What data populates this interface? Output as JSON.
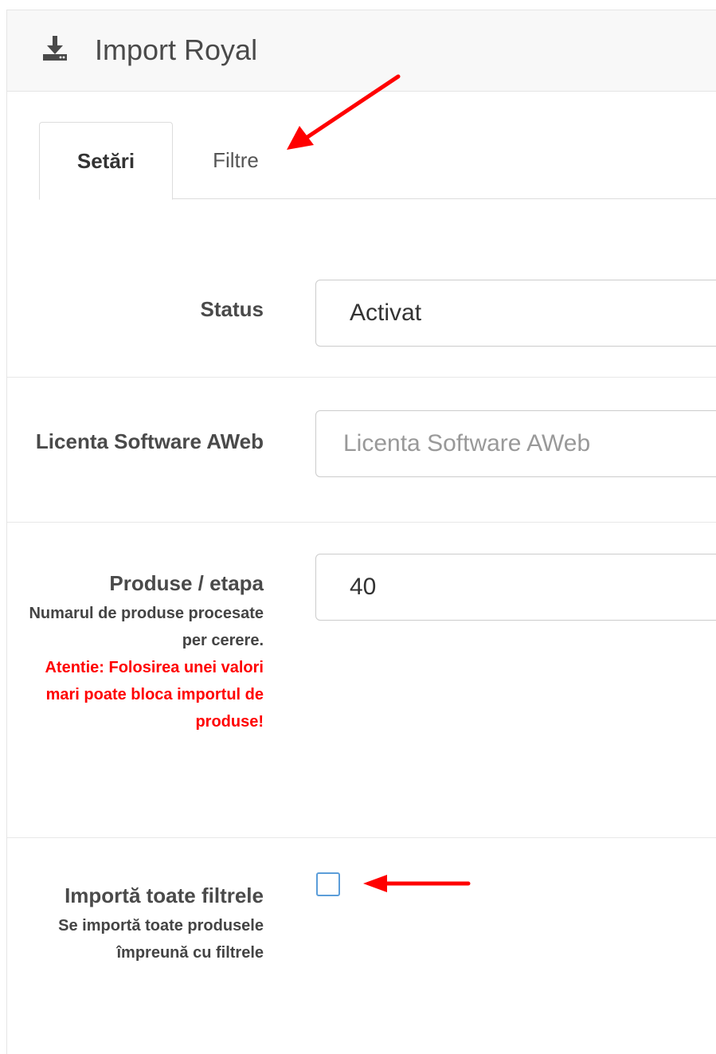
{
  "header": {
    "title": "Import Royal",
    "icon": "download-icon"
  },
  "tabs": [
    {
      "label": "Setări",
      "active": true
    },
    {
      "label": "Filtre",
      "active": false
    }
  ],
  "form": {
    "status": {
      "label": "Status",
      "value": "Activat"
    },
    "license": {
      "label": "Licenta Software AWeb",
      "placeholder": "Licenta Software AWeb",
      "value": ""
    },
    "products_per_step": {
      "label": "Produse / etapa",
      "help": "Numarul de produse procesate per cerere.",
      "warning": "Atentie: Folosirea unei valori mari poate bloca importul de produse!",
      "value": "40"
    },
    "import_all_filters": {
      "label": "Importă toate filtrele",
      "help": "Se importă toate produsele împreună cu filtrele",
      "checked": false
    }
  },
  "colors": {
    "annotation_arrow": "#ff0000",
    "checkbox_border": "#5b9dd9",
    "warning_text": "#ff0000"
  }
}
